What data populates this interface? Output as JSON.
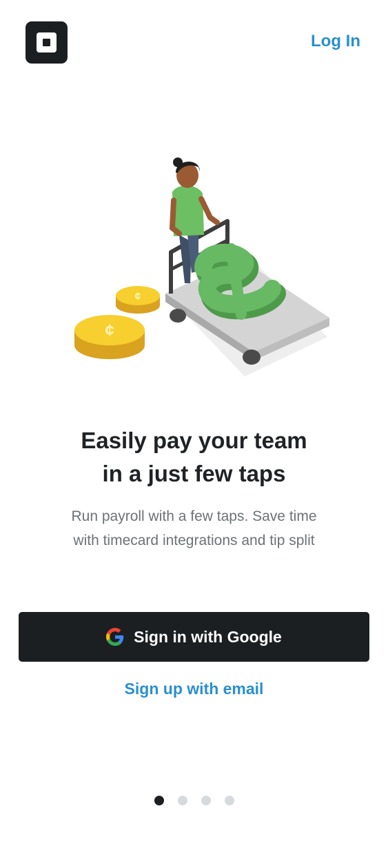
{
  "header": {
    "logo_icon": "square-logo-icon",
    "login_label": "Log In"
  },
  "onboarding": {
    "illustration_icon": "payroll-cart-illustration",
    "headline_line1": "Easily pay your team",
    "headline_line2": "in a just few taps",
    "subtext_line1": "Run payroll with a few taps. Save time",
    "subtext_line2": "with timecard integrations and tip split"
  },
  "actions": {
    "google_icon": "google-g-icon",
    "google_label": "Sign in with Google",
    "email_label": "Sign up with email"
  },
  "pagination": {
    "total": 4,
    "current": 1
  },
  "colors": {
    "accent": "#2a8fcf",
    "dark": "#1b1f22",
    "coin": "#f7cf2f",
    "dollar": "#5cb25a"
  }
}
